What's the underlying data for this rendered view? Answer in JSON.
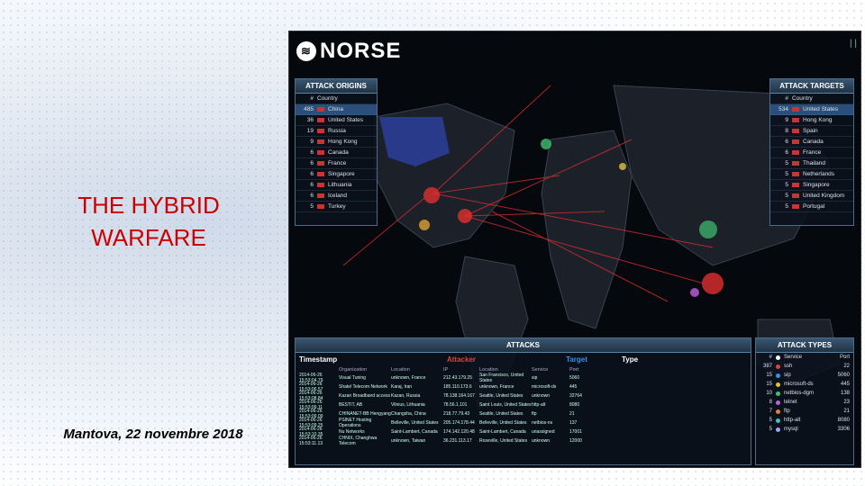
{
  "slide": {
    "title_line1": "THE HYBRID",
    "title_line2": "WARFARE",
    "subtitle": "Mantova, 22 novembre 2018"
  },
  "screenshot": {
    "logo_text": "NORSE",
    "origins": {
      "title": "ATTACK ORIGINS",
      "header_num": "#",
      "header_country": "Country",
      "rows": [
        {
          "n": "485",
          "c": "China"
        },
        {
          "n": "36",
          "c": "United States"
        },
        {
          "n": "19",
          "c": "Russia"
        },
        {
          "n": "9",
          "c": "Hong Kong"
        },
        {
          "n": "6",
          "c": "Canada"
        },
        {
          "n": "6",
          "c": "France"
        },
        {
          "n": "6",
          "c": "Singapore"
        },
        {
          "n": "6",
          "c": "Lithuania"
        },
        {
          "n": "6",
          "c": "Iceland"
        },
        {
          "n": "5",
          "c": "Turkey"
        }
      ]
    },
    "targets": {
      "title": "ATTACK TARGETS",
      "header_num": "#",
      "header_country": "Country",
      "rows": [
        {
          "n": "534",
          "c": "United States"
        },
        {
          "n": "9",
          "c": "Hong Kong"
        },
        {
          "n": "8",
          "c": "Spain"
        },
        {
          "n": "6",
          "c": "Canada"
        },
        {
          "n": "6",
          "c": "France"
        },
        {
          "n": "5",
          "c": "Thailand"
        },
        {
          "n": "5",
          "c": "Netherlands"
        },
        {
          "n": "5",
          "c": "Singapore"
        },
        {
          "n": "5",
          "c": "United Kingdom"
        },
        {
          "n": "5",
          "c": "Portugal"
        }
      ]
    },
    "attacks": {
      "title": "ATTACKS",
      "timestamp_label": "Timestamp",
      "attacker_label": "Attacker",
      "target_label": "Target",
      "type_label": "Type",
      "cols": [
        "Organization",
        "Location",
        "IP",
        "Location",
        "Service",
        "Port"
      ],
      "rows": [
        [
          "2014-06-26 15:53:04.79",
          "Visual Tuning",
          "unknown, France",
          "212.43.179.25",
          "San Francisco, United States",
          "sip",
          "5060"
        ],
        [
          "2014-06-26 15:53:06.57",
          "Shatel Telecom Network",
          "Karaj, Iran",
          "185.110.173.6",
          "unknown, France",
          "microsoft-ds",
          "445"
        ],
        [
          "2014-06-26 15:53:08.84",
          "Kazan Broadband access",
          "Kazan, Russia",
          "78.138.164.167",
          "Seattle, United States",
          "unknown",
          "32764"
        ],
        [
          "2014-06-26 15:53:09.11",
          "BESTIT, AB",
          "Vilnius, Lithuania",
          "78.56.1.101",
          "Saint Louis, United States",
          "http-alt",
          "8080"
        ],
        [
          "2014-06-26 15:53:09.09",
          "CHINANET-BB Hengyang",
          "Changsha, China",
          "218.77.79.43",
          "Seattle, United States",
          "ftp",
          "21"
        ],
        [
          "2014-06-26 15:53:09.25",
          "PSINET Hosting Operations",
          "Belleville, United States",
          "205.174.178.44",
          "Belleville, United States",
          "netbios-ns",
          "137"
        ],
        [
          "2014-06-26 15:53:10.35",
          "Nu Networks",
          "Saint-Lambert, Canada",
          "174.142.120.48",
          "Saint-Lambert, Canada",
          "unassigned",
          "17001"
        ],
        [
          "2014-06-26 15:53:11.13",
          "CHNIX, Changhwa Telecom",
          "unknown, Taiwan",
          "36.231.113.17",
          "Roseville, United States",
          "unknown",
          "12000"
        ]
      ]
    },
    "types": {
      "title": "ATTACK TYPES",
      "header_num": "#",
      "header_service": "Service",
      "header_port": "Port",
      "rows": [
        {
          "n": "387",
          "s": "ssh",
          "p": "22"
        },
        {
          "n": "15",
          "s": "sip",
          "p": "5060"
        },
        {
          "n": "15",
          "s": "microsoft-ds",
          "p": "445"
        },
        {
          "n": "10",
          "s": "netbios-dgm",
          "p": "138"
        },
        {
          "n": "8",
          "s": "telnet",
          "p": "23"
        },
        {
          "n": "7",
          "s": "ftp",
          "p": "21"
        },
        {
          "n": "5",
          "s": "http-alt",
          "p": "8080"
        },
        {
          "n": "5",
          "s": "mysql",
          "p": "3306"
        }
      ],
      "dot_colors": [
        "#e04040",
        "#3a8ee8",
        "#e0c040",
        "#40c070",
        "#c060e0",
        "#e08040",
        "#40c0c0",
        "#a0a0ff"
      ]
    }
  }
}
